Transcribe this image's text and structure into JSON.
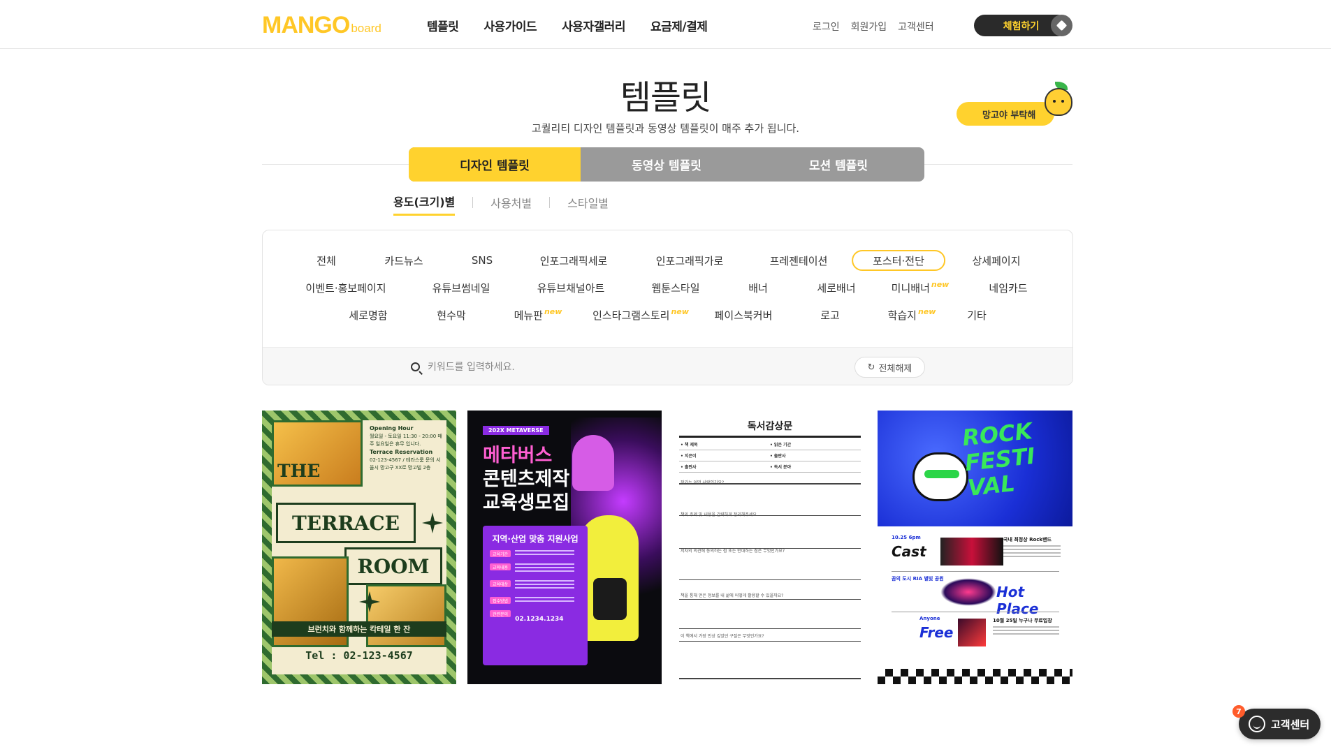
{
  "header": {
    "logo_main": "MANGO",
    "logo_sub": "board",
    "nav": [
      "템플릿",
      "사용가이드",
      "사용자갤러리",
      "요금제/결제"
    ],
    "util": [
      "로그인",
      "회원가입",
      "고객센터"
    ],
    "trial_label": "체험하기"
  },
  "hero": {
    "title": "템플릿",
    "subtitle": "고퀄리티 디자인 템플릿과 동영상 템플릿이 매주 추가 됩니다.",
    "request_label": "망고야 부탁해"
  },
  "main_tabs": [
    "디자인 템플릿",
    "동영상 템플릿",
    "모션 템플릿"
  ],
  "sub_tabs": [
    "용도(크기)별",
    "사용처별",
    "스타일별"
  ],
  "categories": {
    "row1": [
      "전체",
      "카드뉴스",
      "SNS",
      "인포그래픽세로",
      "인포그래픽가로",
      "프레젠테이션",
      "포스터·전단",
      "상세페이지"
    ],
    "row2": [
      "이벤트·홍보페이지",
      "유튜브썸네일",
      "유튜브채널아트",
      "웹툰스타일",
      "배너",
      "세로배너",
      "미니배너",
      "네임카드"
    ],
    "row3": [
      "세로명함",
      "현수막",
      "메뉴판",
      "인스타그램스토리",
      "페이스북커버",
      "로고",
      "학습지",
      "기타"
    ],
    "new_badge": "new",
    "active": "포스터·전단"
  },
  "search": {
    "placeholder": "키워드를 입력하세요.",
    "reset_label": "전체해제"
  },
  "cards": {
    "terrace": {
      "the": "THE",
      "terrace": "TERRACE",
      "room": "ROOM",
      "info1_title": "Opening Hour",
      "info1_text": "월요일 - 토요일 11:30 - 20:00 매주 일요일은 휴무 입니다.",
      "info2_title": "Terrace Reservation",
      "info2_text": "02-123-4567 / 테라스룸 문의 서울시 망고구 XX로 망고빌 2층",
      "band": "브런치와 함께하는 칵테일 한 잔",
      "tel": "Tel : 02-123-4567"
    },
    "metaverse": {
      "chip": "202X METAVERSE",
      "line1": "메타버스",
      "line2": "콘텐츠제작",
      "line3": "교육생모집",
      "panel_title": "지역·산업 맞춤 지원사업",
      "pills": [
        "교육기간",
        "교육내용",
        "교육대상",
        "접수방법",
        "관련문의"
      ],
      "contact": "02.1234.1234"
    },
    "report": {
      "title": "독서감상문",
      "fields": [
        "• 책 제목",
        "• 지은이",
        "• 출판사",
        "• 읽은 기간",
        "• 출판사",
        "• 독서 분야"
      ],
      "questions": [
        "작가는 어떤 사람인가요?",
        "책의 주제 및 내용을 간략하게 정리해주세요.",
        "저자의 의견에 동의하는 점 또는 반대하는 점은 무엇인가요?",
        "책을 통해 얻은 정보를 내 삶에 어떻게 활용할 수 있을까요?",
        "이 책에서 가장 인상 깊었던 구절은 무엇인가요?"
      ]
    },
    "festival": {
      "rock": "ROCK",
      "festi": "FESTI",
      "val": "VAL",
      "s1_title": "10.25 6pm",
      "s1_big": "Cast",
      "s1_desc": "국내 최정상 Rock밴드",
      "s2_title": "꿈의 도시 RIA 별빛 공원",
      "s2_big": "Hot Place",
      "s3_title": "Anyone",
      "s3_big": "Free",
      "s3_desc": "10월 25일 누구나 무료입장"
    }
  },
  "support": {
    "label": "고객센터",
    "badge": "7"
  }
}
